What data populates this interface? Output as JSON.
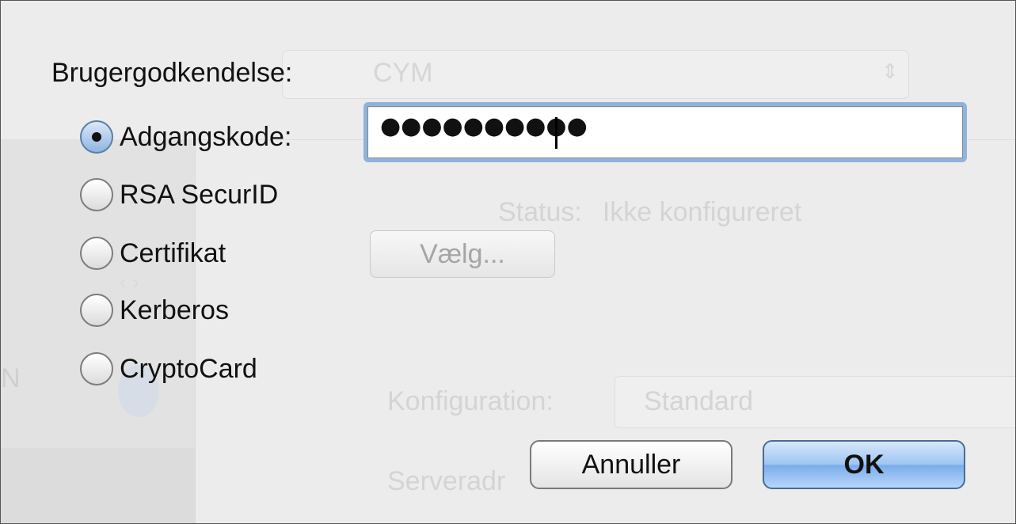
{
  "background": {
    "popup_text": "CYM",
    "status_label": "Status:",
    "status_value": "Ikke konfigureret",
    "sidebar_letter": "N",
    "configuration_label": "Konfiguration:",
    "configuration_value": "Standard",
    "server_label": "Serveradr"
  },
  "dialog": {
    "title": "Brugergodkendelse:",
    "options": [
      {
        "label": "Adgangskode:",
        "selected": true
      },
      {
        "label": "RSA SecurID",
        "selected": false
      },
      {
        "label": "Certifikat",
        "selected": false
      },
      {
        "label": "Kerberos",
        "selected": false
      },
      {
        "label": "CryptoCard",
        "selected": false
      }
    ],
    "password_masked": "●●●●●●●●●●",
    "choose_button": "Vælg...",
    "cancel_button": "Annuller",
    "ok_button": "OK"
  },
  "colors": {
    "focus_ring": "#8fb3dd",
    "default_button": "#79acea"
  }
}
